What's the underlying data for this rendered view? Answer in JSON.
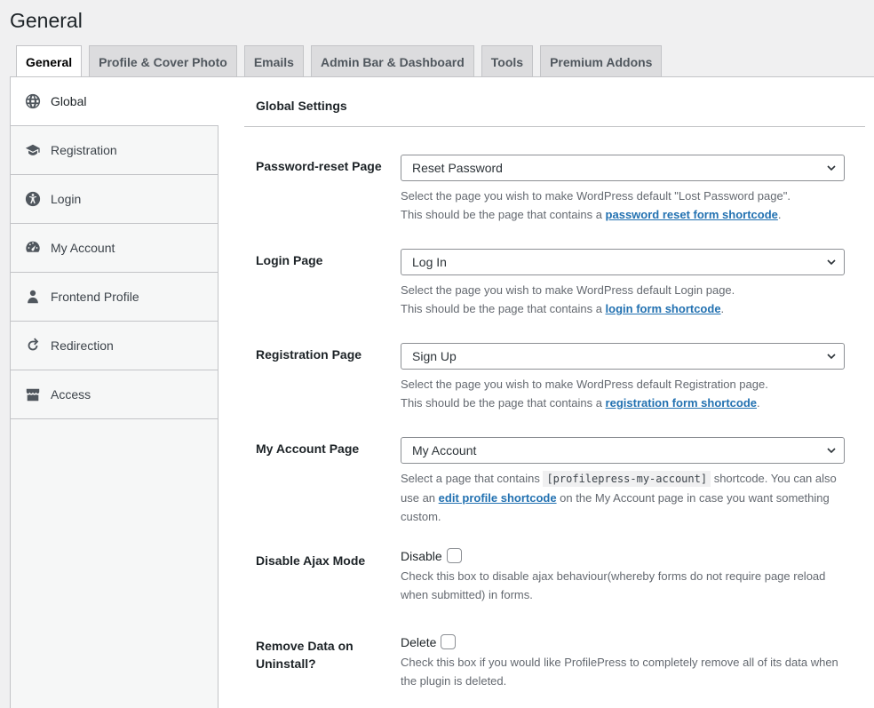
{
  "page_title": "General",
  "tabs": [
    {
      "label": "General",
      "active": true
    },
    {
      "label": "Profile & Cover Photo"
    },
    {
      "label": "Emails"
    },
    {
      "label": "Admin Bar & Dashboard"
    },
    {
      "label": "Tools"
    },
    {
      "label": "Premium Addons"
    }
  ],
  "sidebar": {
    "items": [
      {
        "label": "Global",
        "icon": "globe-icon",
        "active": true
      },
      {
        "label": "Registration",
        "icon": "graduation-cap-icon"
      },
      {
        "label": "Login",
        "icon": "accessibility-icon"
      },
      {
        "label": "My Account",
        "icon": "dashboard-gauge-icon"
      },
      {
        "label": "Frontend Profile",
        "icon": "person-icon"
      },
      {
        "label": "Redirection",
        "icon": "redo-arrow-icon"
      },
      {
        "label": "Access",
        "icon": "store-icon"
      }
    ]
  },
  "main": {
    "section_title": "Global Settings",
    "password_reset": {
      "label": "Password-reset Page",
      "value": "Reset Password",
      "desc1": "Select the page you wish to make WordPress default \"Lost Password page\".",
      "desc2_pre": "This should be the page that contains a ",
      "link": "password reset form shortcode",
      "desc2_post": "."
    },
    "login": {
      "label": "Login Page",
      "value": "Log In",
      "desc1": "Select the page you wish to make WordPress default Login page.",
      "desc2_pre": "This should be the page that contains a ",
      "link": "login form shortcode",
      "desc2_post": "."
    },
    "registration": {
      "label": "Registration Page",
      "value": "Sign Up",
      "desc1": "Select the page you wish to make WordPress default Registration page.",
      "desc2_pre": "This should be the page that contains a ",
      "link": "registration form shortcode",
      "desc2_post": "."
    },
    "my_account": {
      "label": "My Account Page",
      "value": "My Account",
      "desc_pre": "Select a page that contains ",
      "code": "[profilepress-my-account]",
      "desc_mid": " shortcode. You can also use an ",
      "link": "edit profile shortcode",
      "desc_post": " on the My Account page in case you want something custom."
    },
    "ajax": {
      "label": "Disable Ajax Mode",
      "check_label": "Disable",
      "checked": false,
      "desc": "Check this box to disable ajax behaviour(whereby forms do not require page reload when submitted) in forms."
    },
    "remove_data": {
      "label": "Remove Data on Uninstall?",
      "check_label": "Delete",
      "checked": false,
      "desc": "Check this box if you would like ProfilePress to completely remove all of its data when the plugin is deleted."
    }
  }
}
